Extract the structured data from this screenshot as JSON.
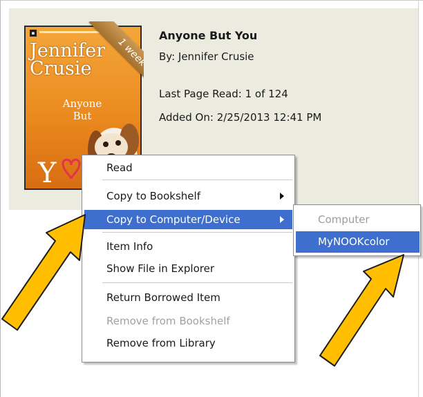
{
  "book": {
    "title": "Anyone But You",
    "author_line": "By:  Jennifer Crusie",
    "last_page_line": "Last Page Read:  1 of 124",
    "added_line": "Added On:  2/25/2013 12:41 PM",
    "ribbon": "1 week",
    "cover": {
      "author": "Jennifer Crusie",
      "title": "Anyone But"
    }
  },
  "context_menu": {
    "items": [
      {
        "label": "Read",
        "state": "normal"
      },
      {
        "label": "Copy to Bookshelf",
        "state": "normal",
        "submenu": true
      },
      {
        "label": "Copy to Computer/Device",
        "state": "selected",
        "submenu": true
      },
      {
        "label": "Item Info",
        "state": "normal"
      },
      {
        "label": "Show File in Explorer",
        "state": "normal"
      },
      {
        "label": "Return Borrowed Item",
        "state": "normal"
      },
      {
        "label": "Remove from Bookshelf",
        "state": "disabled"
      },
      {
        "label": "Remove from Library",
        "state": "normal"
      }
    ]
  },
  "submenu": {
    "items": [
      {
        "label": "Computer",
        "state": "disabled"
      },
      {
        "label": "MyNOOKcolor",
        "state": "selected"
      }
    ]
  },
  "colors": {
    "selection": "#3e6fce",
    "arrow_fill": "#ffbf00",
    "panel": "#ecebe0"
  }
}
